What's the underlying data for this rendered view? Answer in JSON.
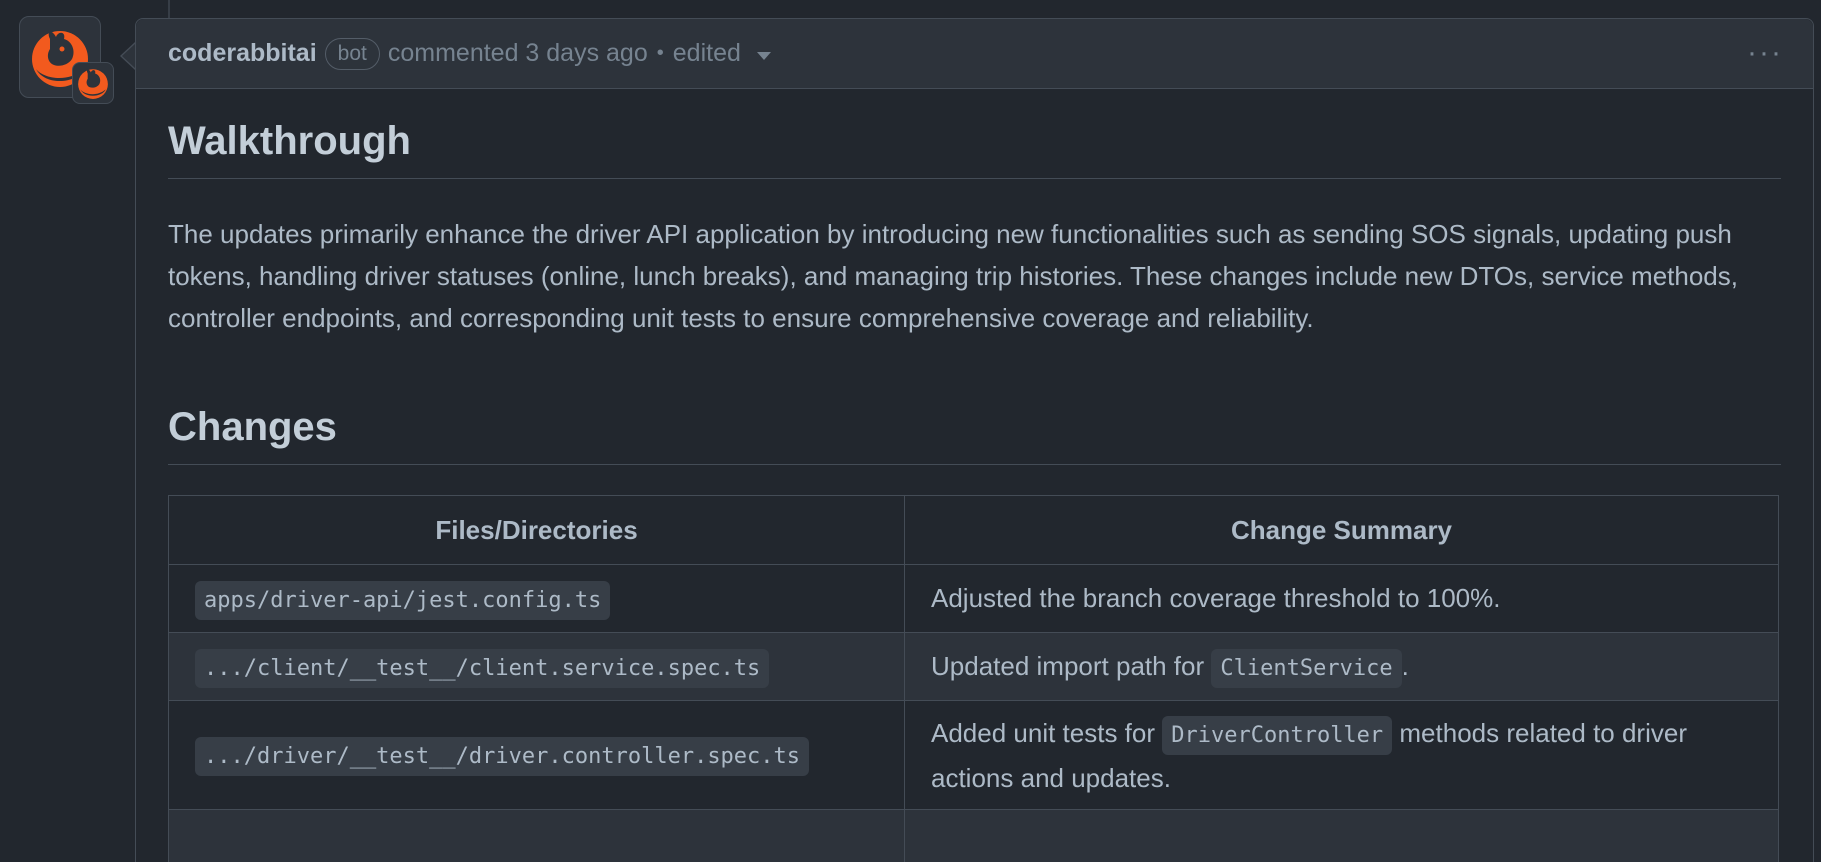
{
  "comment": {
    "author": "coderabbitai",
    "badge": "bot",
    "action": "commented 3 days ago",
    "edited": "edited",
    "more": "···"
  },
  "walkthrough": {
    "heading": "Walkthrough",
    "text": "The updates primarily enhance the driver API application by introducing new functionalities such as sending SOS signals, updating push tokens, handling driver statuses (online, lunch breaks), and managing trip histories. These changes include new DTOs, service methods, controller endpoints, and corresponding unit tests to ensure comprehensive coverage and reliability."
  },
  "changes": {
    "heading": "Changes",
    "headers": [
      "Files/Directories",
      "Change Summary"
    ],
    "rows": [
      {
        "file": "apps/driver-api/jest.config.ts",
        "summary_before": "Adjusted the branch coverage threshold to 100%.",
        "summary_code": "",
        "summary_after": ""
      },
      {
        "file": ".../client/__test__/client.service.spec.ts",
        "summary_before": "Updated import path for ",
        "summary_code": "ClientService",
        "summary_after": "."
      },
      {
        "file": ".../driver/__test__/driver.controller.spec.ts",
        "summary_before": "Added unit tests for ",
        "summary_code": "DriverController",
        "summary_after": " methods related to driver actions and updates."
      }
    ]
  },
  "colors": {
    "background": "#22272e",
    "header": "#2d333b",
    "border": "#444c56",
    "brand": "#f25a1e"
  },
  "icons": {
    "avatar": "rabbit-logo-icon",
    "menu": "kebab-icon",
    "dropdown": "chevron-down-icon"
  }
}
